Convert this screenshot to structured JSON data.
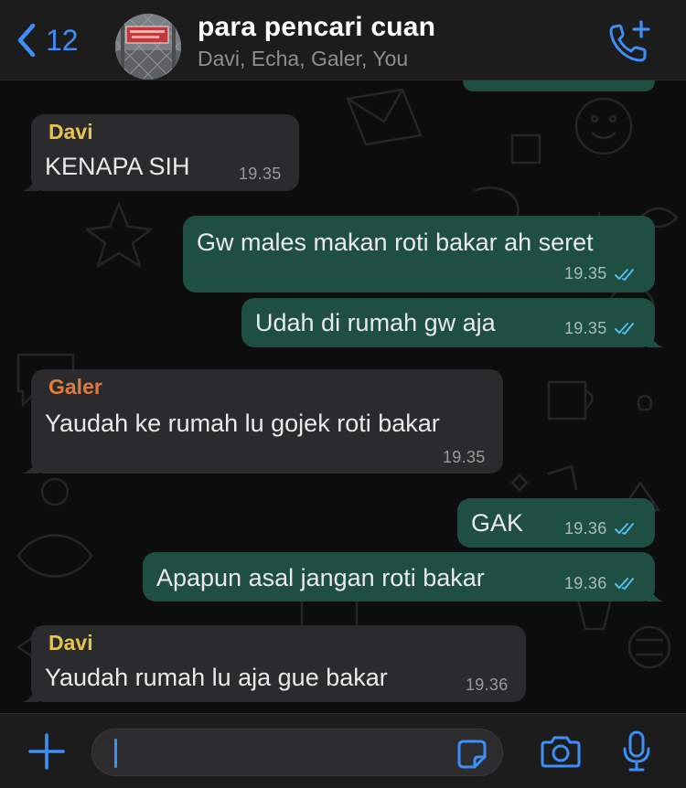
{
  "header": {
    "back_count": "12",
    "title": "para pencari cuan",
    "subtitle": "Davi, Echa, Galer, You",
    "call_icon": "phone-plus-icon",
    "back_icon": "chevron-left-icon"
  },
  "colors": {
    "accent": "#3e8ef7",
    "incoming_bubble": "#2b2b2d",
    "outgoing_bubble": "#1f4f43",
    "davi": "#e8c54a",
    "galer": "#e07b3a",
    "read_ticks": "#53bdeb"
  },
  "messages": [
    {
      "direction": "in",
      "sender": "Davi",
      "text": "KENAPA SIH",
      "time": "19.35"
    },
    {
      "direction": "out",
      "text": "Gw males makan roti bakar ah seret",
      "time": "19.35",
      "status": "read"
    },
    {
      "direction": "out",
      "text": "Udah di rumah gw aja",
      "time": "19.35",
      "status": "read"
    },
    {
      "direction": "in",
      "sender": "Galer",
      "text": "Yaudah ke rumah lu gojek roti bakar",
      "time": "19.35"
    },
    {
      "direction": "out",
      "text": "GAK",
      "time": "19.36",
      "status": "read"
    },
    {
      "direction": "out",
      "text": "Apapun asal jangan roti bakar",
      "time": "19.36",
      "status": "read"
    },
    {
      "direction": "in",
      "sender": "Davi",
      "text": "Yaudah rumah lu aja gue bakar",
      "time": "19.36"
    }
  ],
  "inputbar": {
    "plus_icon": "plus-icon",
    "sticker_icon": "sticker-icon",
    "camera_icon": "camera-icon",
    "mic_icon": "microphone-icon"
  }
}
